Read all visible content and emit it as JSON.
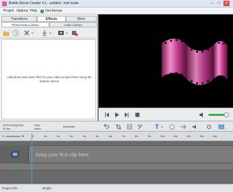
{
  "window": {
    "title": "Bolide Movie Creator 4.1 - untitled - trial mode"
  },
  "menu": [
    {
      "label": "Project"
    },
    {
      "label": "Options"
    },
    {
      "label": "Help"
    },
    {
      "label": "Get license"
    }
  ],
  "tabs": [
    {
      "label": "Transitions"
    },
    {
      "label": "Effects"
    },
    {
      "label": "More"
    }
  ],
  "subtabs": [
    {
      "label": "Photo/Video Library"
    },
    {
      "label": "Audio Library"
    }
  ],
  "library": {
    "hint": "Add photo and video files for your video project here using the buttons above"
  },
  "timeline_bar": {
    "resolution": "1920x1080(16/9)",
    "fps": "30 fps",
    "mode_line1": "Portr",
    "mode_line2": "video",
    "automate": "Automate"
  },
  "ruler": {
    "ticks": [
      "0",
      "1s",
      "2s",
      "3s",
      "4s",
      "5s",
      "6s",
      "7s",
      "8s",
      "9s",
      "10s",
      "11s",
      "12s",
      "13s",
      "14s"
    ]
  },
  "timeline": {
    "drag_hint": "Drag your first clip here"
  },
  "status": {
    "project_info": "Project info",
    "state": "Empty"
  },
  "colors": {
    "accent": "#4aa3ff",
    "volume_green": "#3cb043",
    "film_pink": "#e05fa8"
  }
}
